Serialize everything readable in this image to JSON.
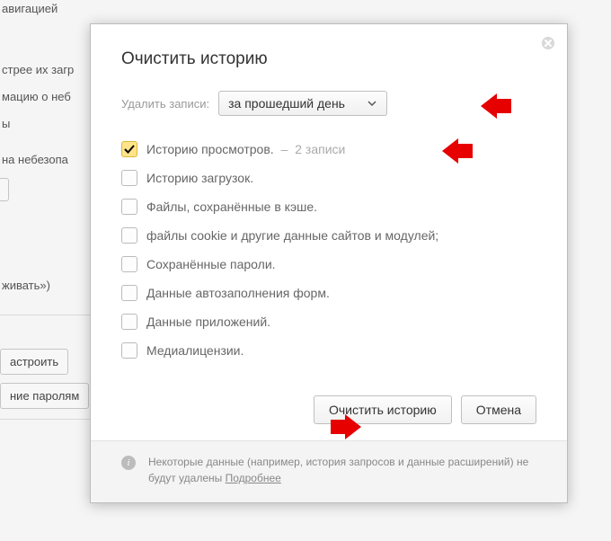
{
  "background": {
    "t1": "авигацией",
    "t2": "стрее их загр",
    "t3": "мацию о неб",
    "t4": "ы",
    "t5": "на небезопа",
    "t6": "живать»)",
    "b1": "астроить",
    "b2": "ние паролям"
  },
  "modal": {
    "title": "Очистить историю",
    "range_label": "Удалить записи:",
    "range_value": "за прошедший день",
    "items": [
      {
        "label": "Историю просмотров.",
        "sub": "2 записи",
        "checked": true
      },
      {
        "label": "Историю загрузок.",
        "sub": "",
        "checked": false
      },
      {
        "label": "Файлы, сохранённые в кэше.",
        "sub": "",
        "checked": false
      },
      {
        "label": "файлы cookie и другие данные сайтов и модулей;",
        "sub": "",
        "checked": false
      },
      {
        "label": "Сохранённые пароли.",
        "sub": "",
        "checked": false
      },
      {
        "label": "Данные автозаполнения форм.",
        "sub": "",
        "checked": false
      },
      {
        "label": "Данные приложений.",
        "sub": "",
        "checked": false
      },
      {
        "label": "Медиалицензии.",
        "sub": "",
        "checked": false
      }
    ],
    "dash": "–",
    "btn_clear": "Очистить историю",
    "btn_cancel": "Отмена",
    "footer_text": "Некоторые данные (например, история запросов и данные расширений) не будут удалены ",
    "footer_link": "Подробнее"
  }
}
